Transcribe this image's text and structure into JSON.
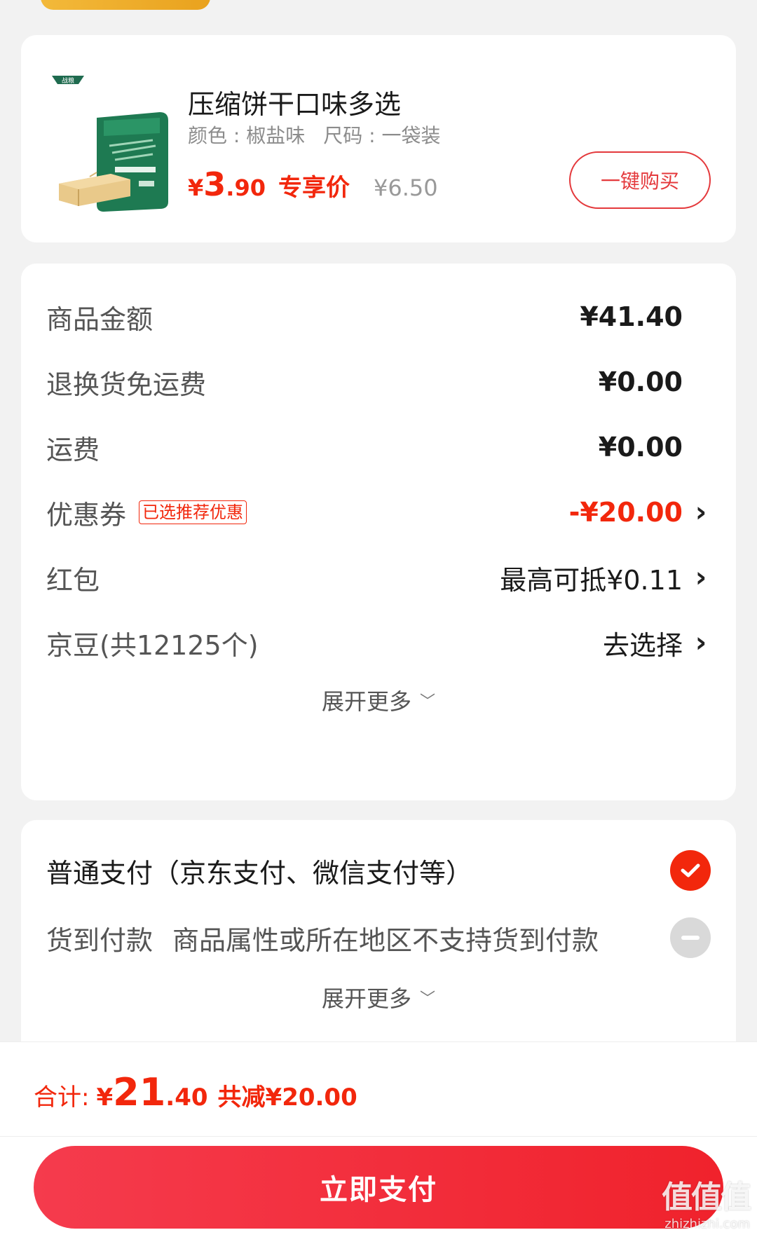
{
  "product": {
    "title": "压缩饼干口味多选",
    "color_spec": "颜色 : 椒盐味",
    "size_spec": "尺码 : 一袋装",
    "price_currency": "¥",
    "price_integer": "3",
    "price_decimal": ".90",
    "price_tag": "专享价",
    "original_price": "¥6.50",
    "buy_button": "一键购买",
    "brand_logo_text": "战粮"
  },
  "fees": {
    "goods_amount": {
      "label": "商品金额",
      "value": "¥41.40"
    },
    "return_shipping": {
      "label": "退换货免运费",
      "value": "¥0.00"
    },
    "shipping": {
      "label": "运费",
      "value": "¥0.00"
    },
    "coupon": {
      "label": "优惠券",
      "badge": "已选推荐优惠",
      "value": "-¥20.00"
    },
    "red_packet": {
      "label": "红包",
      "value": "最高可抵¥0.11"
    },
    "jd_beans": {
      "label": "京豆(共12125个)",
      "value": "去选择"
    },
    "expand_label": "展开更多"
  },
  "payment": {
    "normal": {
      "label": "普通支付（京东支付、微信支付等）",
      "selected": true
    },
    "cod": {
      "label": "货到付款",
      "note": "商品属性或所在地区不支持货到付款",
      "disabled": true
    },
    "expand_label": "展开更多"
  },
  "summary": {
    "total_label": "合计:",
    "currency": "¥",
    "total_integer": "21",
    "total_decimal": ".40",
    "saved": "共减¥20.00",
    "pay_button": "立即支付"
  },
  "watermark": {
    "text": "值值值",
    "url": "zhizhizhi.com"
  },
  "colors": {
    "accent": "#f2270c",
    "button_start": "#f53b4d",
    "button_end": "#f0222c"
  }
}
